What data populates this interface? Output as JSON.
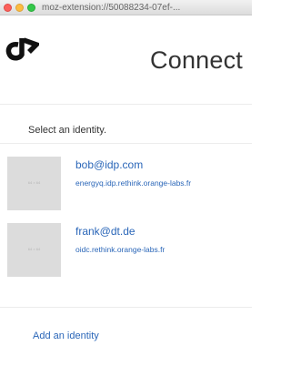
{
  "window": {
    "url": "moz-extension://50088234-07ef-..."
  },
  "header": {
    "logo_icon": "rethink-logo-icon",
    "title": "Connect"
  },
  "prompt": "Select an identity.",
  "identities": [
    {
      "email": "bob@idp.com",
      "idp": "energyq.idp.rethink.orange-labs.fr",
      "thumbnail_text": "64 × 64"
    },
    {
      "email": "frank@dt.de",
      "idp": "oidc.rethink.orange-labs.fr",
      "thumbnail_text": "64 × 64"
    }
  ],
  "actions": {
    "add_identity": "Add an identity"
  },
  "colors": {
    "link": "#2a66b8",
    "thumbnail_bg": "#dcdcdc",
    "divider": "#ececec"
  }
}
